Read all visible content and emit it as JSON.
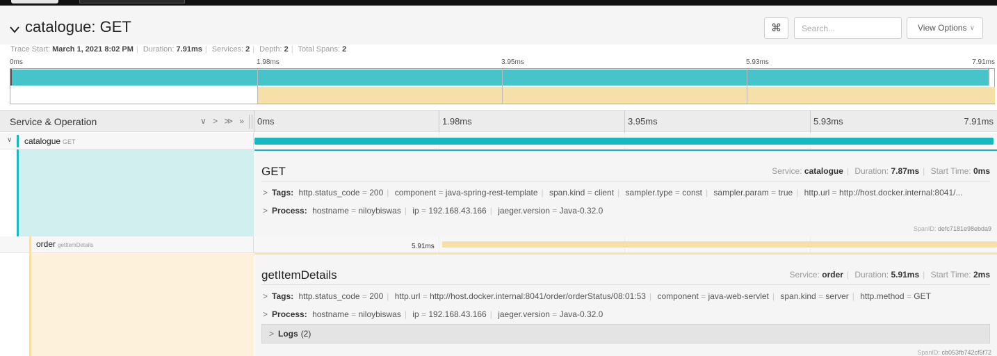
{
  "trace": {
    "title": "catalogue: GET",
    "search_placeholder": "Search...",
    "cmd_glyph": "⌘",
    "view_options_label": "View Options",
    "meta": {
      "start_label": "Trace Start:",
      "start_value": "March 1, 2021 8:02 PM",
      "duration_label": "Duration:",
      "duration_value": "7.91ms",
      "services_label": "Services:",
      "services_value": "2",
      "depth_label": "Depth:",
      "depth_value": "2",
      "spans_label": "Total Spans:",
      "spans_value": "2"
    }
  },
  "minimap": {
    "ticks": [
      "0ms",
      "1.98ms",
      "3.95ms",
      "5.93ms",
      "7.91ms"
    ]
  },
  "timeline_header": {
    "service_operation_label": "Service & Operation",
    "collapse_controls": "∨ > ≫ »",
    "ticks": [
      "0ms",
      "1.98ms",
      "3.95ms",
      "5.93ms",
      "7.91ms"
    ]
  },
  "spans": [
    {
      "service": "catalogue",
      "operation": "GET",
      "color": "#17b8be",
      "detail": {
        "title": "GET",
        "service_label": "Service:",
        "service_value": "catalogue",
        "duration_label": "Duration:",
        "duration_value": "7.87ms",
        "start_label": "Start Time:",
        "start_value": "0ms",
        "tags_label": "Tags:",
        "tags": [
          {
            "k": "http.status_code",
            "v": "200"
          },
          {
            "k": "component",
            "v": "java-spring-rest-template"
          },
          {
            "k": "span.kind",
            "v": "client"
          },
          {
            "k": "sampler.type",
            "v": "const"
          },
          {
            "k": "sampler.param",
            "v": "true"
          },
          {
            "k": "http.url",
            "v": "http://host.docker.internal:8041/..."
          }
        ],
        "process_label": "Process:",
        "process": [
          {
            "k": "hostname",
            "v": "niloybiswas"
          },
          {
            "k": "ip",
            "v": "192.168.43.166"
          },
          {
            "k": "jaeger.version",
            "v": "Java-0.32.0"
          }
        ],
        "spanid_label": "SpanID:",
        "spanid_value": "defc7181e98ebda9"
      }
    },
    {
      "service": "order",
      "operation": "getItemDetails",
      "color": "#f7dfa8",
      "duration_text": "5.91ms",
      "detail": {
        "title": "getItemDetails",
        "service_label": "Service:",
        "service_value": "order",
        "duration_label": "Duration:",
        "duration_value": "5.91ms",
        "start_label": "Start Time:",
        "start_value": "2ms",
        "tags_label": "Tags:",
        "tags": [
          {
            "k": "http.status_code",
            "v": "200"
          },
          {
            "k": "http.url",
            "v": "http://host.docker.internal:8041/order/orderStatus/08:01:53"
          },
          {
            "k": "component",
            "v": "java-web-servlet"
          },
          {
            "k": "span.kind",
            "v": "server"
          },
          {
            "k": "http.method",
            "v": "GET"
          }
        ],
        "process_label": "Process:",
        "process": [
          {
            "k": "hostname",
            "v": "niloybiswas"
          },
          {
            "k": "ip",
            "v": "192.168.43.166"
          },
          {
            "k": "jaeger.version",
            "v": "Java-0.32.0"
          }
        ],
        "logs_label": "Logs",
        "logs_count": "(2)",
        "spanid_label": "SpanID:",
        "spanid_value": "cb053fb742cf5f72"
      }
    }
  ]
}
